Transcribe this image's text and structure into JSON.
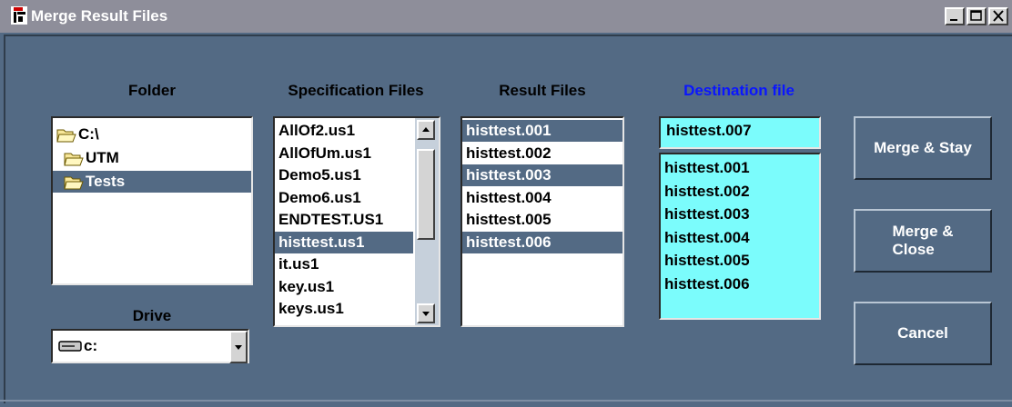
{
  "window": {
    "title": "Merge Result Files",
    "controls": [
      "minimize",
      "maximize",
      "close"
    ]
  },
  "labels": {
    "folder": "Folder",
    "spec_files": "Specification Files",
    "result_files": "Result Files",
    "destination": "Destination file",
    "drive": "Drive"
  },
  "folder_tree": [
    {
      "label": "C:\\",
      "icon": "open-folder-icon",
      "selected": false
    },
    {
      "label": "UTM",
      "icon": "open-folder-icon",
      "selected": false
    },
    {
      "label": "Tests",
      "icon": "open-folder-icon",
      "selected": true
    }
  ],
  "spec_files": [
    {
      "label": "AllOf2.us1",
      "selected": false
    },
    {
      "label": "AllOfUm.us1",
      "selected": false
    },
    {
      "label": "Demo5.us1",
      "selected": false
    },
    {
      "label": "Demo6.us1",
      "selected": false
    },
    {
      "label": "ENDTEST.US1",
      "selected": false
    },
    {
      "label": "histtest.us1",
      "selected": true
    },
    {
      "label": "it.us1",
      "selected": false
    },
    {
      "label": "key.us1",
      "selected": false
    },
    {
      "label": "keys.us1",
      "selected": false
    }
  ],
  "result_files": [
    {
      "label": "histtest.001",
      "selected": true
    },
    {
      "label": "histtest.002",
      "selected": false
    },
    {
      "label": "histtest.003",
      "selected": true
    },
    {
      "label": "histtest.004",
      "selected": false
    },
    {
      "label": "histtest.005",
      "selected": false
    },
    {
      "label": "histtest.006",
      "selected": true
    }
  ],
  "destination": {
    "value": "histtest.007",
    "files": [
      "histtest.001",
      "histtest.002",
      "histtest.003",
      "histtest.004",
      "histtest.005",
      "histtest.006"
    ]
  },
  "drive": {
    "value": "c:",
    "icon": "drive-icon"
  },
  "buttons": {
    "merge_stay": "Merge & Stay",
    "merge_close_line1": "Merge &",
    "merge_close_line2": "Close",
    "cancel": "Cancel"
  },
  "colors": {
    "background": "#536a84",
    "selection": "#536a84",
    "destination_bg": "#7bfcfc",
    "destination_label": "#0a16ff",
    "titlebar": "#8e8e9a"
  }
}
